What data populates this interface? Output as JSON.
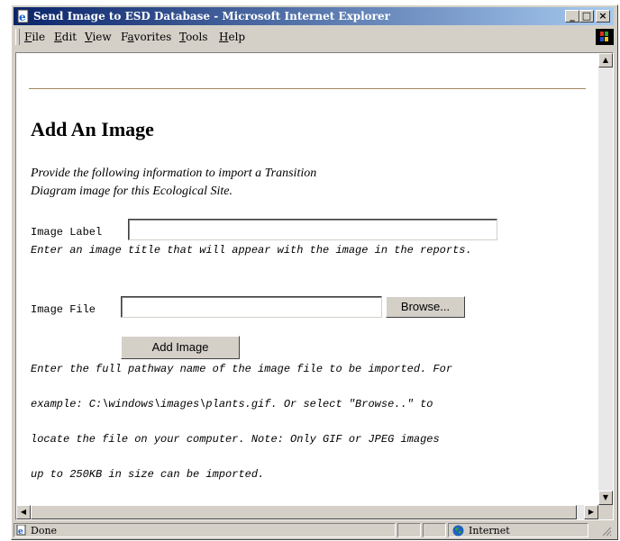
{
  "window": {
    "title": "Send Image to ESD Database - Microsoft Internet Explorer",
    "controls": {
      "minimize": "_",
      "maximize": "□",
      "close": "×"
    }
  },
  "menu": {
    "items": [
      {
        "label": "File",
        "mnemonic": "F",
        "rest": "ile"
      },
      {
        "label": "Edit",
        "mnemonic": "E",
        "rest": "dit"
      },
      {
        "label": "View",
        "mnemonic": "V",
        "rest": "iew"
      },
      {
        "label": "Favorites",
        "pre": "F",
        "mnemonic": "a",
        "rest": "vorites"
      },
      {
        "label": "Tools",
        "mnemonic": "T",
        "rest": "ools"
      },
      {
        "label": "Help",
        "mnemonic": "H",
        "rest": "elp"
      }
    ]
  },
  "page": {
    "heading": "Add An Image",
    "intro_line1": "Provide the following information to import a Transition",
    "intro_line2": "Diagram image for this Ecological Site.",
    "image_label": {
      "label": "Image Label",
      "value": "",
      "hint": "Enter an image title that will appear with the image in the reports."
    },
    "image_file": {
      "label": "Image File",
      "value": "",
      "browse_label": "Browse..."
    },
    "add_button_label": "Add Image",
    "instructions": [
      "Enter the full pathway name of the image file to be imported.  For",
      "example:  C:\\windows\\images\\plants.gif.  Or select \"Browse..\" to",
      "locate the file on your computer.  Note:  Only GIF or JPEG images",
      "up to 250KB in size can be imported."
    ]
  },
  "status": {
    "text": "Done",
    "zone": "Internet"
  },
  "icons": [
    "ie-page-icon",
    "windows-logo-icon",
    "globe-icon",
    "resize-grip-icon"
  ]
}
